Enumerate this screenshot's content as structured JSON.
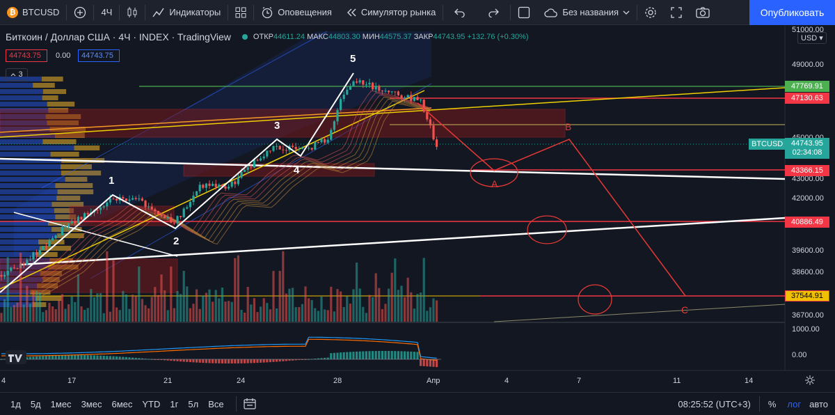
{
  "toolbar": {
    "symbol": "BTCUSD",
    "symbol_logo": "₿",
    "interval": "4Ч",
    "indicators": "Индикаторы",
    "alerts": "Оповещения",
    "replay": "Симулятор рынка",
    "layout_name": "Без названия",
    "publish": "Опубликовать"
  },
  "legend": {
    "title": "Биткоин / Доллар США · 4Ч · INDEX · TradingView",
    "open_label": "ОТКР",
    "open": "44611.24",
    "high_label": "МАКС",
    "high": "44803.30",
    "low_label": "МИН",
    "low": "44575.37",
    "close_label": "ЗАКР",
    "close": "44743.95",
    "change": "+132.76 (+0.30%)",
    "bid": "44743.75",
    "spread": "0.00",
    "ask": "44743.75",
    "collapsed_count": "3"
  },
  "axis": {
    "currency": "USD",
    "price_labels": [
      "51000.00",
      "49000.00",
      "45000.00",
      "43000.00",
      "42000.00",
      "39600.00",
      "38600.00",
      "36700.00"
    ],
    "indicator_labels": [
      "1000.00",
      "0.00"
    ],
    "time_labels": [
      "4",
      "17",
      "21",
      "24",
      "28",
      "Апр",
      "4",
      "7",
      "11",
      "14"
    ]
  },
  "price_tags": [
    {
      "value": "47769.91",
      "color": "#4caf50"
    },
    {
      "value": "47130.63",
      "color": "#f23645"
    },
    {
      "value": "43366.15",
      "color": "#f23645"
    },
    {
      "value": "40886.49",
      "color": "#f23645"
    },
    {
      "value": "37544.91",
      "color": "#f0c000"
    }
  ],
  "last_price": {
    "symbol": "BTCUSD",
    "value": "44743.95",
    "countdown": "02:34:08"
  },
  "wave_labels": [
    "1",
    "2",
    "3",
    "4",
    "5"
  ],
  "abc_labels": [
    "A",
    "B",
    "C"
  ],
  "bottom": {
    "timeframes": [
      "1д",
      "5д",
      "1мес",
      "3мес",
      "6мес",
      "YTD",
      "1г",
      "5л",
      "Все"
    ],
    "clock": "08:25:52 (UTC+3)",
    "percent": "%",
    "log": "лог",
    "auto": "авто"
  },
  "colors": {
    "up": "#26a69a",
    "down": "#ef5350",
    "accent": "#2962ff",
    "bg": "#131722"
  }
}
